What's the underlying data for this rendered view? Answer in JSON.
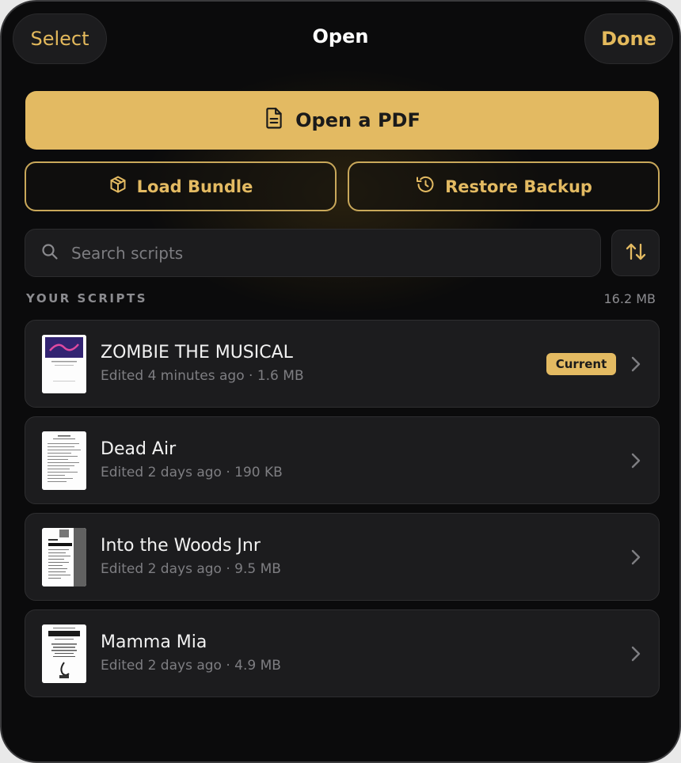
{
  "header": {
    "select_label": "Select",
    "title": "Open",
    "done_label": "Done"
  },
  "actions": {
    "open_pdf_label": "Open a PDF",
    "load_bundle_label": "Load Bundle",
    "restore_backup_label": "Restore Backup"
  },
  "search": {
    "placeholder": "Search scripts",
    "value": ""
  },
  "section": {
    "label": "YOUR SCRIPTS",
    "total_size": "16.2 MB"
  },
  "scripts": [
    {
      "title": "ZOMBIE THE MUSICAL",
      "subtitle": "Edited 4 minutes ago · 1.6 MB",
      "badge": "Current"
    },
    {
      "title": "Dead Air",
      "subtitle": "Edited 2 days ago · 190 KB"
    },
    {
      "title": "Into the Woods Jnr",
      "subtitle": "Edited 2 days ago · 9.5 MB"
    },
    {
      "title": "Mamma Mia",
      "subtitle": "Edited 2 days ago · 4.9 MB"
    }
  ],
  "icons": {
    "open_pdf": "document-icon",
    "load_bundle": "package-icon",
    "restore_backup": "history-icon",
    "search": "search-icon",
    "sort": "sort-arrows-icon",
    "row_action": "chevron-right-icon"
  },
  "colors": {
    "accent": "#e3ba62",
    "background": "#0b0b0c",
    "card": "#1c1c1e",
    "secondary_text": "#7e7e82"
  }
}
